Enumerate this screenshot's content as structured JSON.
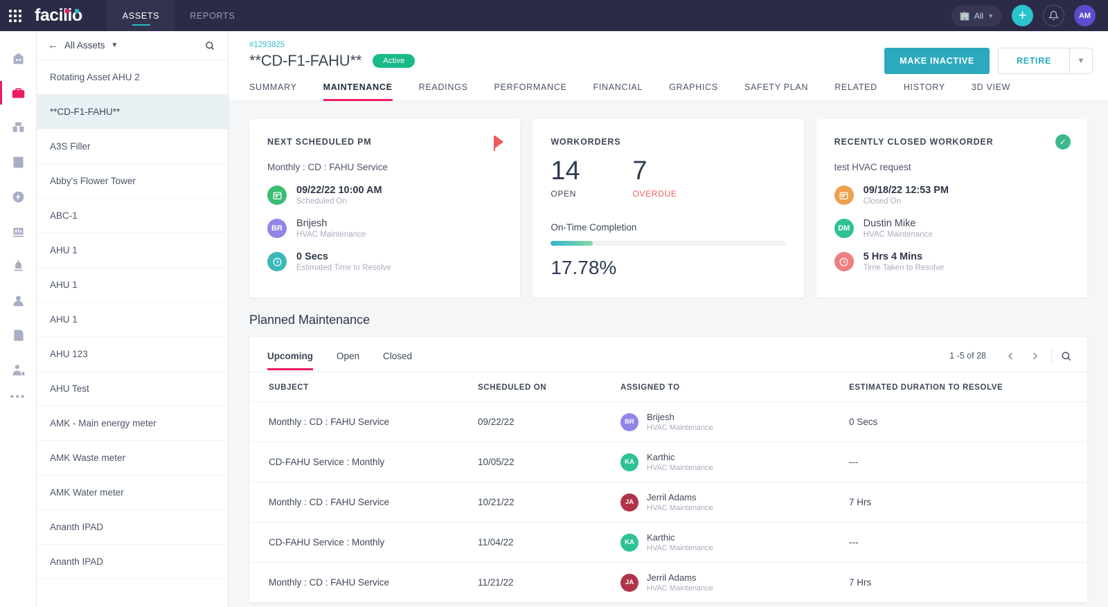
{
  "topbar": {
    "apps_icon": "grid-apps-icon",
    "brand": "facilio",
    "tabs": [
      {
        "label": "ASSETS",
        "active": true
      },
      {
        "label": "REPORTS",
        "active": false
      }
    ],
    "site_selector": {
      "label": "All",
      "icon": "building-icon",
      "caret": "chevron-down-icon"
    },
    "add_button": "+",
    "notifications_icon": "bell-icon",
    "avatar": "AM"
  },
  "rail": {
    "items": [
      {
        "name": "building-icon",
        "active": false
      },
      {
        "name": "toolbox-assets-icon",
        "active": true
      },
      {
        "name": "inventory-boxes-icon",
        "active": false
      },
      {
        "name": "maintenance-wrench-icon",
        "active": false
      },
      {
        "name": "energy-bolt-icon",
        "active": false
      },
      {
        "name": "chart-meter-icon",
        "active": false
      },
      {
        "name": "alarm-icon",
        "active": false
      },
      {
        "name": "tenant-user-icon",
        "active": false
      },
      {
        "name": "invoice-document-icon",
        "active": false
      },
      {
        "name": "technician-icon",
        "active": false
      }
    ],
    "more": "•••"
  },
  "asset_list": {
    "back_icon": "arrow-left-icon",
    "title": "All Assets",
    "caret_icon": "chevron-down-icon",
    "search_icon": "search-icon",
    "items": [
      {
        "label": "Rotating Asset AHU 2",
        "active": false
      },
      {
        "label": "**CD-F1-FAHU**",
        "active": true
      },
      {
        "label": "A3S Filler",
        "active": false
      },
      {
        "label": "Abby's Flower Tower",
        "active": false
      },
      {
        "label": "ABC-1",
        "active": false
      },
      {
        "label": "AHU 1",
        "active": false
      },
      {
        "label": "AHU 1",
        "active": false
      },
      {
        "label": "AHU 1",
        "active": false
      },
      {
        "label": "AHU 123",
        "active": false
      },
      {
        "label": "AHU Test",
        "active": false
      },
      {
        "label": "AMK - Main energy meter",
        "active": false
      },
      {
        "label": "AMK Waste meter",
        "active": false
      },
      {
        "label": "AMK Water meter",
        "active": false
      },
      {
        "label": "Ananth IPAD",
        "active": false
      },
      {
        "label": "Ananth IPAD",
        "active": false
      }
    ]
  },
  "detail": {
    "record_id": "#1293825",
    "title": "**CD-F1-FAHU**",
    "status_badge": "Active",
    "primary_action": "MAKE INACTIVE",
    "secondary_action": "RETIRE",
    "secondary_caret": "chevron-down-icon",
    "tabs": [
      {
        "label": "SUMMARY",
        "active": false
      },
      {
        "label": "MAINTENANCE",
        "active": true
      },
      {
        "label": "READINGS",
        "active": false
      },
      {
        "label": "PERFORMANCE",
        "active": false
      },
      {
        "label": "FINANCIAL",
        "active": false
      },
      {
        "label": "GRAPHICS",
        "active": false
      },
      {
        "label": "SAFETY PLAN",
        "active": false
      },
      {
        "label": "RELATED",
        "active": false
      },
      {
        "label": "HISTORY",
        "active": false
      },
      {
        "label": "3D VIEW",
        "active": false
      }
    ]
  },
  "cards": {
    "next_pm": {
      "title": "NEXT SCHEDULED PM",
      "corner_icon": "flag-icon",
      "subject": "Monthly : CD : FAHU Service",
      "rows": [
        {
          "icon": "calendar-icon",
          "color": "#3bbd74",
          "initials": "",
          "main": "09/22/22 10:00 AM",
          "sub": "Scheduled On"
        },
        {
          "icon": "avatar",
          "color": "#8f86e8",
          "initials": "BR",
          "main": "Brijesh",
          "sub": "HVAC Maintenance"
        },
        {
          "icon": "clock-icon",
          "color": "#3bb9b9",
          "initials": "",
          "main": "0 Secs",
          "sub": "Estimated Time to Resolve"
        }
      ]
    },
    "workorders": {
      "title": "WORKORDERS",
      "open_count": "14",
      "open_label": "OPEN",
      "overdue_count": "7",
      "overdue_label": "OVERDUE",
      "ontime_label": "On-Time Completion",
      "ontime_percent": "17.78%",
      "ontime_value": 17.78,
      "accent_start": "#36b3cd",
      "accent_end": "#86d9a3",
      "overdue_color": "#f1595c"
    },
    "recently_closed": {
      "title": "RECENTLY CLOSED WORKORDER",
      "corner_icon": "check-circle-icon",
      "subject": "test HVAC request",
      "rows": [
        {
          "icon": "calendar-icon",
          "color": "#eda04e",
          "initials": "",
          "main": "09/18/22 12:53 PM",
          "sub": "Closed On"
        },
        {
          "icon": "avatar",
          "color": "#2ec294",
          "initials": "DM",
          "main": "Dustin Mike",
          "sub": "HVAC Maintenance"
        },
        {
          "icon": "clock-icon",
          "color": "#ef7e80",
          "initials": "",
          "main": "5 Hrs 4 Mins",
          "sub": "Time Taken to Resolve"
        }
      ]
    }
  },
  "planned_maintenance": {
    "heading": "Planned Maintenance",
    "tabs": [
      {
        "label": "Upcoming",
        "active": true
      },
      {
        "label": "Open",
        "active": false
      },
      {
        "label": "Closed",
        "active": false
      }
    ],
    "pagination": {
      "range": "1 -5 of 28",
      "prev_icon": "chevron-left-icon",
      "next_icon": "chevron-right-icon",
      "search_icon": "search-icon"
    },
    "columns": [
      "SUBJECT",
      "SCHEDULED ON",
      "ASSIGNED TO",
      "ESTIMATED DURATION TO RESOLVE"
    ],
    "rows": [
      {
        "subject": "Monthly : CD : FAHU Service",
        "scheduled_on": "09/22/22",
        "assignee": {
          "initials": "BR",
          "name": "Brijesh",
          "role": "HVAC Maintenance",
          "color": "#8f86e8"
        },
        "duration": "0 Secs"
      },
      {
        "subject": "CD-FAHU Service : Monthly",
        "scheduled_on": "10/05/22",
        "assignee": {
          "initials": "KA",
          "name": "Karthic",
          "role": "HVAC Maintenance",
          "color": "#2ec294"
        },
        "duration": "---"
      },
      {
        "subject": "Monthly : CD : FAHU Service",
        "scheduled_on": "10/21/22",
        "assignee": {
          "initials": "JA",
          "name": "Jerril Adams",
          "role": "HVAC Maintenance",
          "color": "#b03347"
        },
        "duration": "7 Hrs"
      },
      {
        "subject": "CD-FAHU Service : Monthly",
        "scheduled_on": "11/04/22",
        "assignee": {
          "initials": "KA",
          "name": "Karthic",
          "role": "HVAC Maintenance",
          "color": "#2ec294"
        },
        "duration": "---"
      },
      {
        "subject": "Monthly : CD : FAHU Service",
        "scheduled_on": "11/21/22",
        "assignee": {
          "initials": "JA",
          "name": "Jerril Adams",
          "role": "HVAC Maintenance",
          "color": "#b03347"
        },
        "duration": "7 Hrs"
      }
    ]
  }
}
